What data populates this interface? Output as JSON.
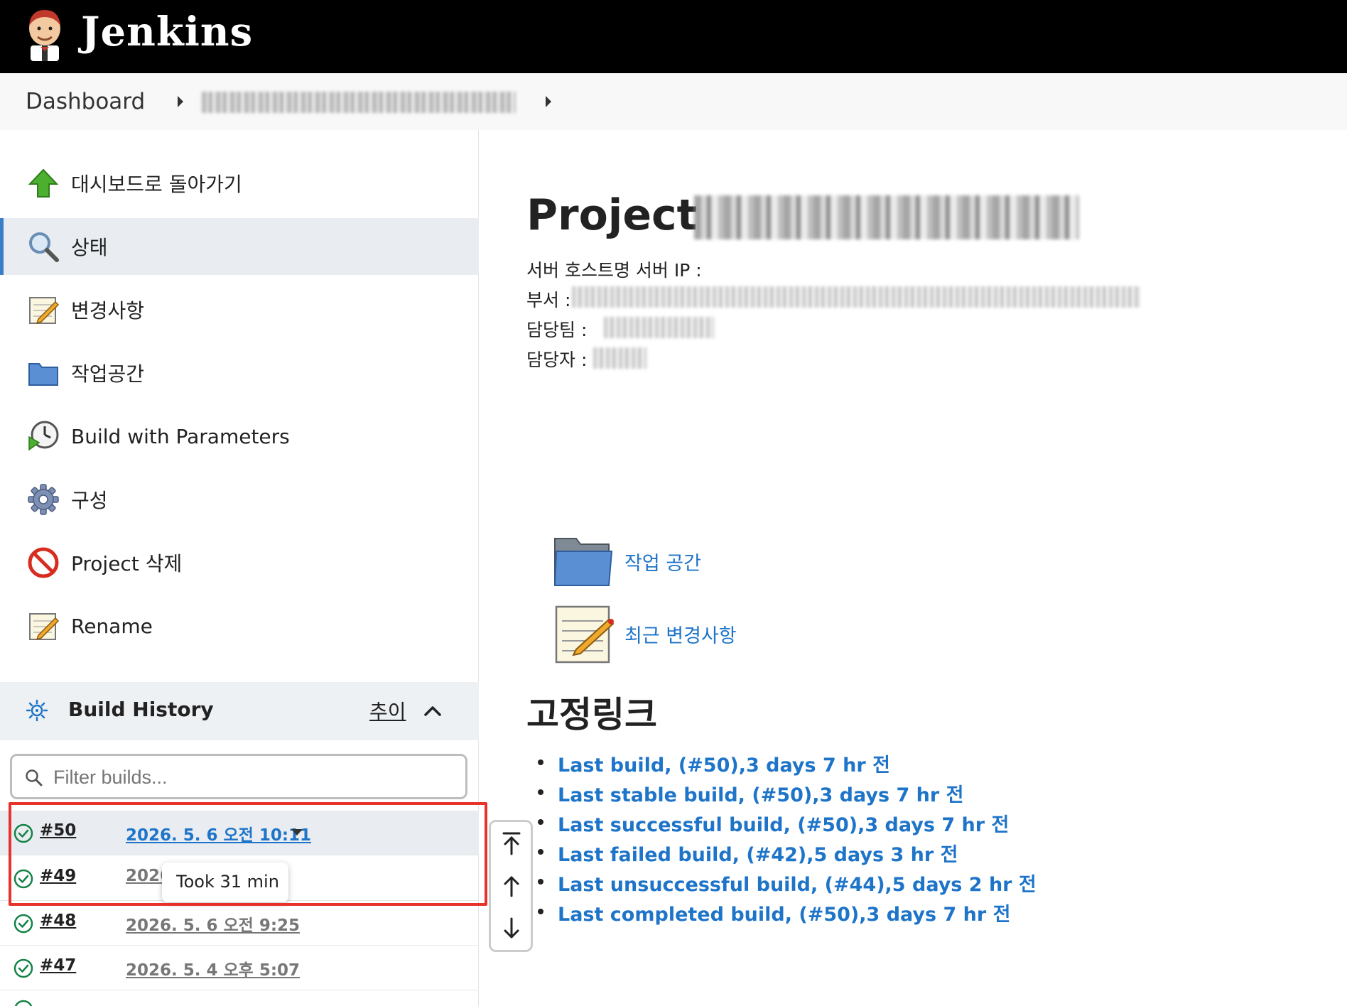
{
  "header": {
    "app_name": "Jenkins",
    "logo_icon": "jenkins-butler-icon"
  },
  "breadcrumb": {
    "dashboard": "Dashboard"
  },
  "sidebar": {
    "tasks": [
      {
        "label": "대시보드로 돌아가기",
        "icon": "up-arrow-icon"
      },
      {
        "label": "상태",
        "icon": "search-icon"
      },
      {
        "label": "변경사항",
        "icon": "notepad-icon"
      },
      {
        "label": "작업공간",
        "icon": "folder-icon"
      },
      {
        "label": "Build with Parameters",
        "icon": "clock-play-icon"
      },
      {
        "label": "구성",
        "icon": "gear-icon"
      },
      {
        "label": "Project 삭제",
        "icon": "no-entry-icon"
      },
      {
        "label": "Rename",
        "icon": "notepad-icon"
      }
    ]
  },
  "build_history": {
    "title": "Build History",
    "trend": "추이",
    "filter_placeholder": "Filter builds...",
    "builds": [
      {
        "number": "#50",
        "date": "2026. 5. 6 오전 10:11"
      },
      {
        "number": "#49",
        "date": "2026"
      },
      {
        "number": "#48",
        "date": "2026. 5. 6 오전 9:25"
      },
      {
        "number": "#47",
        "date": "2026. 5. 4 오후 5:07"
      }
    ],
    "tooltip": "Took 31 min"
  },
  "main": {
    "title_prefix": "Project",
    "desc": {
      "host_line": "서버 호스트명  서버 IP :",
      "dept": "부서 :",
      "team": "담당팀 :",
      "owner": "담당자 :"
    },
    "links": [
      {
        "label": "작업 공간",
        "icon": "folder-icon"
      },
      {
        "label": "최근 변경사항",
        "icon": "notepad-icon"
      }
    ],
    "permalinks_title": "고정링크",
    "permalinks": [
      "Last build, (#50),3 days 7 hr 전",
      "Last stable build, (#50),3 days 7 hr 전",
      "Last successful build, (#50),3 days 7 hr 전",
      "Last failed build, (#42),5 days 3 hr 전",
      "Last unsuccessful build, (#44),5 days 2 hr 전",
      "Last completed build, (#50),3 days 7 hr 전"
    ]
  },
  "colors": {
    "header_bg": "#000000",
    "link": "#1e74c8",
    "highlight": "#e8322c",
    "success": "#138347"
  }
}
